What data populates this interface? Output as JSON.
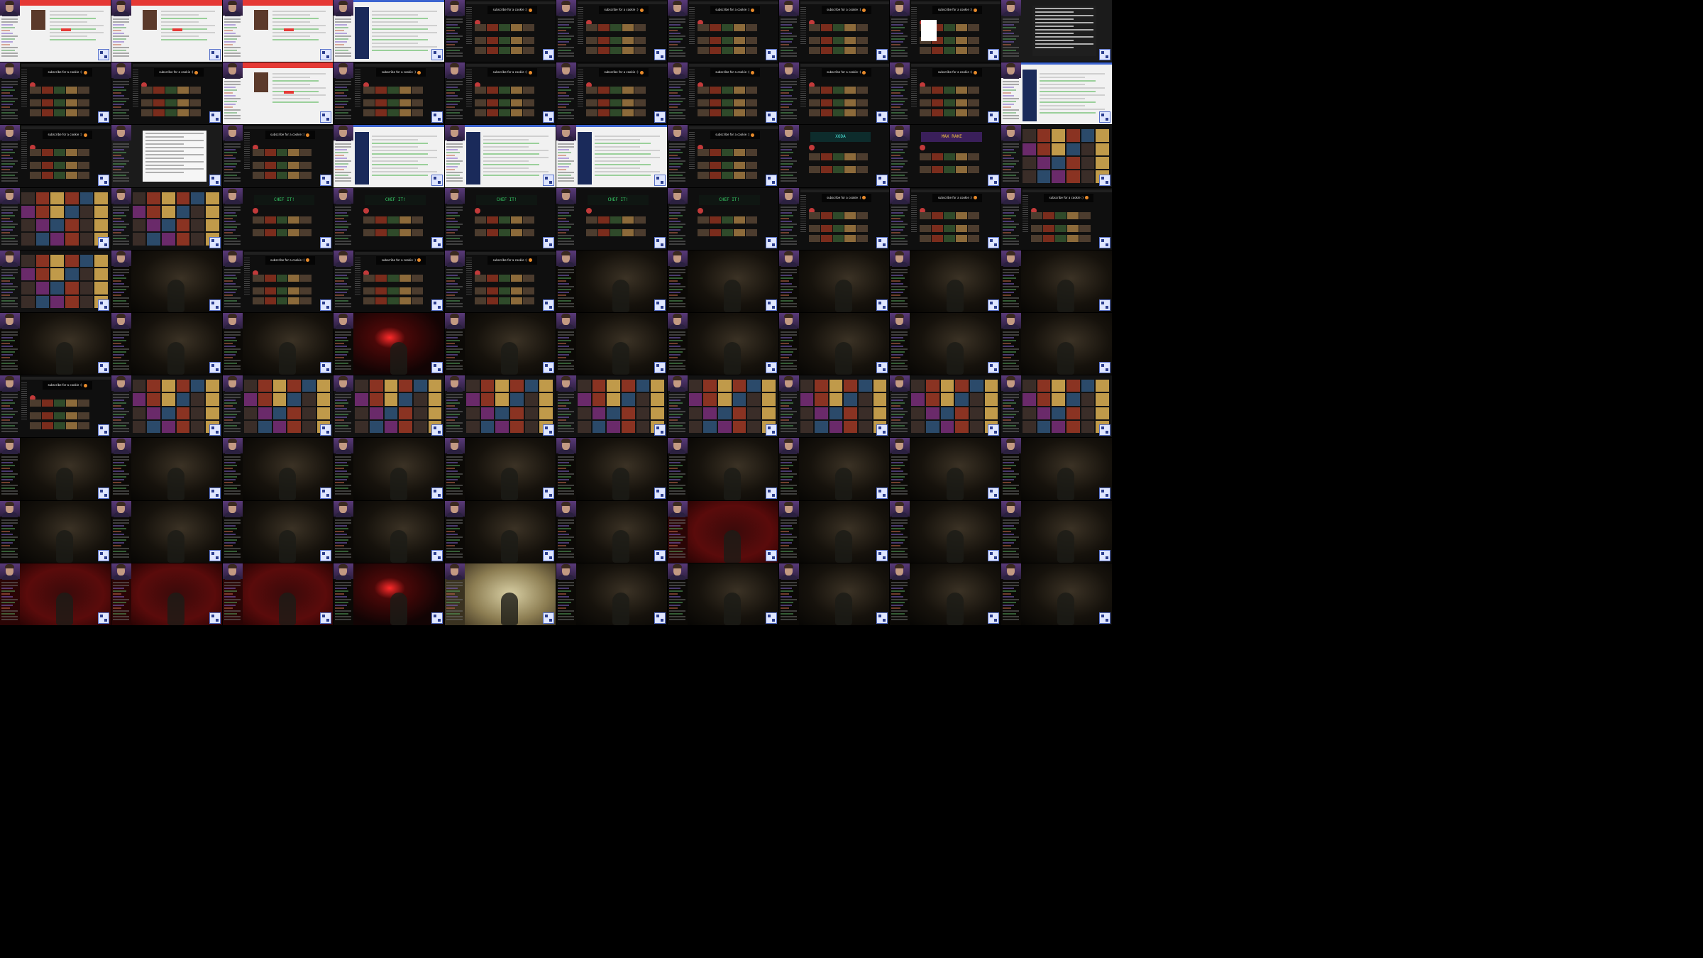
{
  "grid": {
    "columns": 10,
    "rows": 10
  },
  "tiles": [
    {
      "kind": "light"
    },
    {
      "kind": "light"
    },
    {
      "kind": "light"
    },
    {
      "kind": "sheet"
    },
    {
      "kind": "youtube"
    },
    {
      "kind": "youtube"
    },
    {
      "kind": "youtube"
    },
    {
      "kind": "youtube"
    },
    {
      "kind": "youtube-dialog"
    },
    {
      "kind": "editor-dark"
    },
    {
      "kind": "youtube"
    },
    {
      "kind": "youtube"
    },
    {
      "kind": "light"
    },
    {
      "kind": "youtube"
    },
    {
      "kind": "youtube"
    },
    {
      "kind": "youtube"
    },
    {
      "kind": "youtube"
    },
    {
      "kind": "youtube"
    },
    {
      "kind": "youtube"
    },
    {
      "kind": "sheet"
    },
    {
      "kind": "youtube"
    },
    {
      "kind": "editor"
    },
    {
      "kind": "youtube"
    },
    {
      "kind": "sheet"
    },
    {
      "kind": "sheet"
    },
    {
      "kind": "sheet"
    },
    {
      "kind": "youtube"
    },
    {
      "kind": "brand-teal"
    },
    {
      "kind": "brand-purple"
    },
    {
      "kind": "gallery"
    },
    {
      "kind": "gallery"
    },
    {
      "kind": "gallery"
    },
    {
      "kind": "brand-green"
    },
    {
      "kind": "brand-green"
    },
    {
      "kind": "brand-green"
    },
    {
      "kind": "brand-green"
    },
    {
      "kind": "brand-green"
    },
    {
      "kind": "youtube"
    },
    {
      "kind": "youtube"
    },
    {
      "kind": "youtube"
    },
    {
      "kind": "gallery"
    },
    {
      "kind": "game"
    },
    {
      "kind": "youtube"
    },
    {
      "kind": "youtube"
    },
    {
      "kind": "youtube"
    },
    {
      "kind": "game"
    },
    {
      "kind": "game"
    },
    {
      "kind": "game"
    },
    {
      "kind": "game"
    },
    {
      "kind": "game"
    },
    {
      "kind": "game"
    },
    {
      "kind": "game"
    },
    {
      "kind": "game"
    },
    {
      "kind": "game-hot"
    },
    {
      "kind": "game"
    },
    {
      "kind": "game"
    },
    {
      "kind": "game"
    },
    {
      "kind": "game"
    },
    {
      "kind": "game"
    },
    {
      "kind": "game"
    },
    {
      "kind": "youtube"
    },
    {
      "kind": "gallery"
    },
    {
      "kind": "gallery"
    },
    {
      "kind": "gallery"
    },
    {
      "kind": "gallery"
    },
    {
      "kind": "gallery"
    },
    {
      "kind": "gallery"
    },
    {
      "kind": "gallery"
    },
    {
      "kind": "gallery"
    },
    {
      "kind": "gallery"
    },
    {
      "kind": "game"
    },
    {
      "kind": "game"
    },
    {
      "kind": "game"
    },
    {
      "kind": "game"
    },
    {
      "kind": "game"
    },
    {
      "kind": "game"
    },
    {
      "kind": "game"
    },
    {
      "kind": "game"
    },
    {
      "kind": "game"
    },
    {
      "kind": "game"
    },
    {
      "kind": "game"
    },
    {
      "kind": "game"
    },
    {
      "kind": "game"
    },
    {
      "kind": "game"
    },
    {
      "kind": "game"
    },
    {
      "kind": "game"
    },
    {
      "kind": "game-red"
    },
    {
      "kind": "game"
    },
    {
      "kind": "game"
    },
    {
      "kind": "game"
    },
    {
      "kind": "game-red"
    },
    {
      "kind": "game-red"
    },
    {
      "kind": "game-red"
    },
    {
      "kind": "game-hot"
    },
    {
      "kind": "game-tan"
    },
    {
      "kind": "game"
    },
    {
      "kind": "game"
    },
    {
      "kind": "game"
    },
    {
      "kind": "game"
    },
    {
      "kind": "game"
    }
  ],
  "texts": {
    "youtube_banner": "subscribe for a cookie :)",
    "brand_green": "CHEF IT!",
    "brand_teal": "XODA",
    "brand_purple": "MAX RAKE"
  },
  "colors": {
    "youtube_bg": "#0f0f0f",
    "accent_red": "#e53935",
    "cam_purple": "#5a3a7a"
  }
}
